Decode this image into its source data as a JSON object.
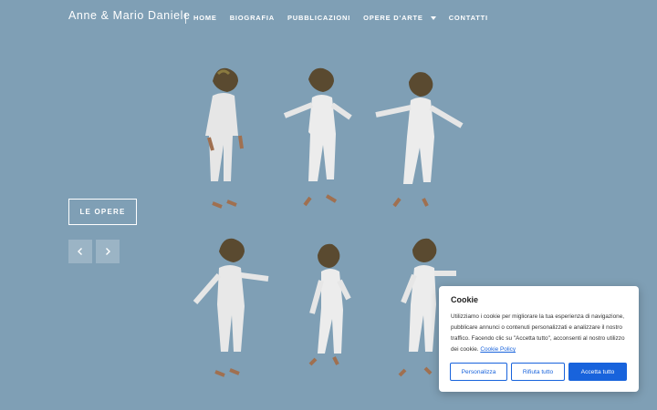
{
  "header": {
    "brand": "Anne & Mario Daniele",
    "nav": [
      {
        "label": "HOME"
      },
      {
        "label": "BIOGRAFIA"
      },
      {
        "label": "PUBBLICAZIONI"
      },
      {
        "label": "OPERE D'ARTE"
      },
      {
        "label": "CONTATTI"
      }
    ]
  },
  "hero": {
    "cta_label": "LE OPERE",
    "prev_icon": "chevron-left-icon",
    "next_icon": "chevron-right-icon"
  },
  "cookie": {
    "title": "Cookie",
    "text": "Utilizziamo i cookie per migliorare la tua esperienza di navigazione, pubblicare annunci o contenuti personalizzati e analizzare il nostro traffico. Facendo clic su \"Accetta tutto\", acconsenti al nostro utilizzo dei cookie.",
    "policy_link": "Cookie Policy",
    "customize_label": "Personalizza",
    "reject_label": "Rifiuta tutto",
    "accept_label": "Accetta tutto"
  },
  "colors": {
    "background": "#7f9fb5",
    "accent": "#1863dc"
  }
}
